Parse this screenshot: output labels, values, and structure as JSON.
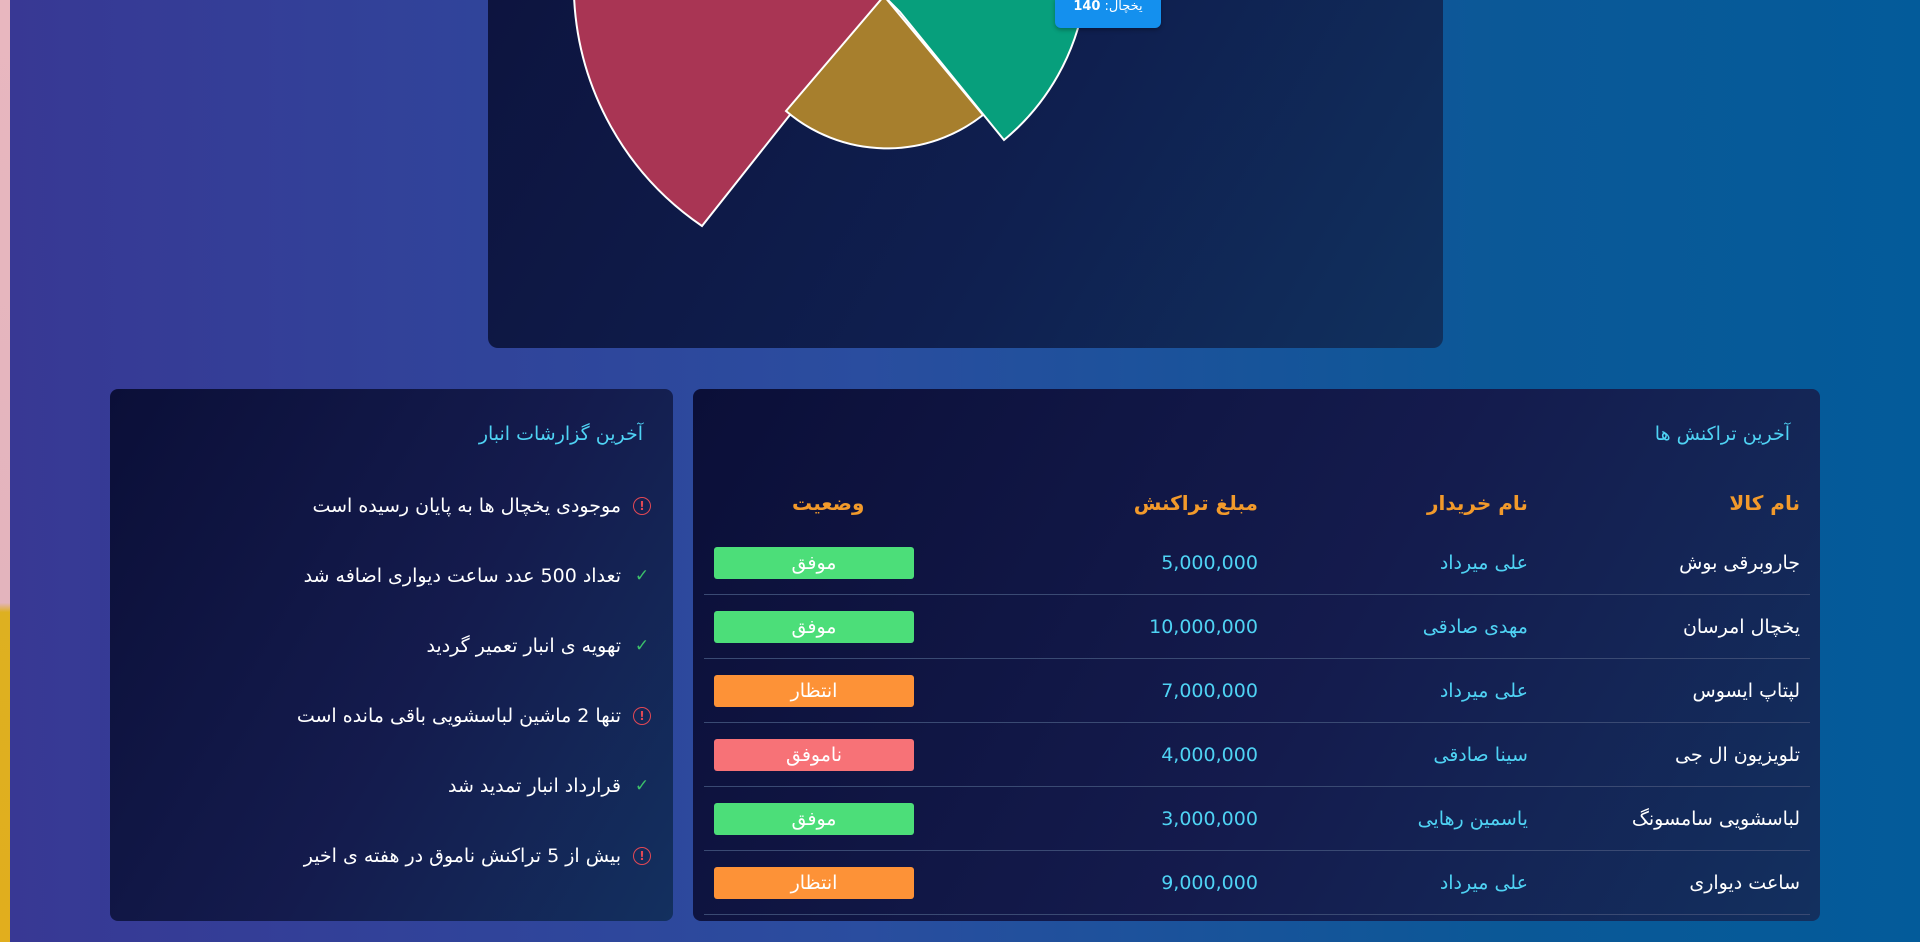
{
  "colors": {
    "accent_cyan": "#4fd3f4",
    "header_orange": "#f29a2b",
    "status_success": "#4cde79",
    "status_pending": "#fd9237",
    "status_failed": "#f77277",
    "warning_red": "#e24855",
    "check_green": "#3cc06a",
    "pie_red": "#a93554",
    "pie_gold": "#a77f2d",
    "pie_green": "#079f7c",
    "tooltip_blue": "#1490ee"
  },
  "chart": {
    "tooltip": {
      "label": "یخچال:",
      "value": "140"
    }
  },
  "reports": {
    "title": "آخرین گزارشات انبار",
    "items": [
      {
        "text": "موجودی یخچال ها به پایان رسیده است",
        "icon": "warning-icon"
      },
      {
        "text": "تعداد 500 عدد ساعت دیواری اضافه شد",
        "icon": "check-icon"
      },
      {
        "text": "تهویه ی انبار تعمیر گردید",
        "icon": "check-icon"
      },
      {
        "text": "تنها 2 ماشین لباسشویی باقی مانده است",
        "icon": "warning-icon"
      },
      {
        "text": "قرارداد انبار تمدید شد",
        "icon": "check-icon"
      },
      {
        "text": "بیش از 5 تراکنش ناموق در هفته ی اخیر",
        "icon": "warning-icon"
      }
    ]
  },
  "transactions": {
    "title": "آخرین تراکنش ها",
    "headers": {
      "item": "نام کالا",
      "buyer": "نام خریدار",
      "amount": "مبلغ تراکنش",
      "status": "وضعیت"
    },
    "rows": [
      {
        "item": "جاروبرقی بوش",
        "buyer": "علی میرداد",
        "amount": "5,000,000",
        "status": "موفق",
        "status_color": "#4cde79"
      },
      {
        "item": "یخچال امرسان",
        "buyer": "مهدی صادقی",
        "amount": "10,000,000",
        "status": "موفق",
        "status_color": "#4cde79"
      },
      {
        "item": "لپتاپ ایسوس",
        "buyer": "علی میرداد",
        "amount": "7,000,000",
        "status": "انتظار",
        "status_color": "#fd9237"
      },
      {
        "item": "تلویزیون ال جی",
        "buyer": "سینا صادقی",
        "amount": "4,000,000",
        "status": "ناموفق",
        "status_color": "#f77277"
      },
      {
        "item": "لباسشویی سامسونگ",
        "buyer": "یاسمین رهایی",
        "amount": "3,000,000",
        "status": "موفق",
        "status_color": "#4cde79"
      },
      {
        "item": "ساعت دیواری",
        "buyer": "علی میرداد",
        "amount": "9,000,000",
        "status": "انتظار",
        "status_color": "#fd9237"
      }
    ]
  }
}
